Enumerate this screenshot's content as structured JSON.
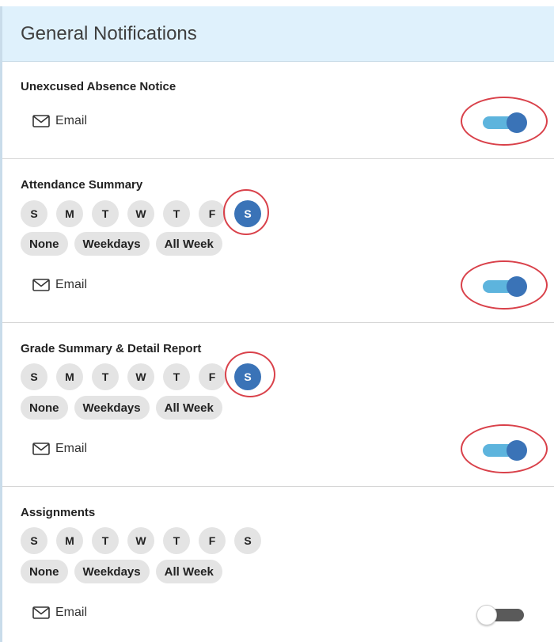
{
  "header": {
    "title": "General Notifications"
  },
  "weekday_letters": [
    "S",
    "M",
    "T",
    "W",
    "T",
    "F",
    "S"
  ],
  "preset_labels": {
    "none": "None",
    "weekdays": "Weekdays",
    "all_week": "All Week"
  },
  "email_label": "Email",
  "icons": {
    "channel": "envelope-icon"
  },
  "colors": {
    "header_bg": "#dff1fc",
    "selected_day": "#3a73b7",
    "toggle_on_track": "#5db4dd",
    "toggle_on_knob": "#3a73b7",
    "toggle_off_track": "#5a5a5a",
    "highlight_ring": "#d9414a"
  },
  "sections": [
    {
      "title": "Unexcused Absence Notice",
      "has_schedule": false,
      "email_enabled": true
    },
    {
      "title": "Attendance Summary",
      "has_schedule": true,
      "selected_days": [
        "Saturday"
      ],
      "email_enabled": true
    },
    {
      "title": "Grade Summary & Detail Report",
      "has_schedule": true,
      "selected_days": [
        "Saturday"
      ],
      "email_enabled": true
    },
    {
      "title": "Assignments",
      "has_schedule": true,
      "selected_days": [],
      "email_enabled": false
    }
  ]
}
